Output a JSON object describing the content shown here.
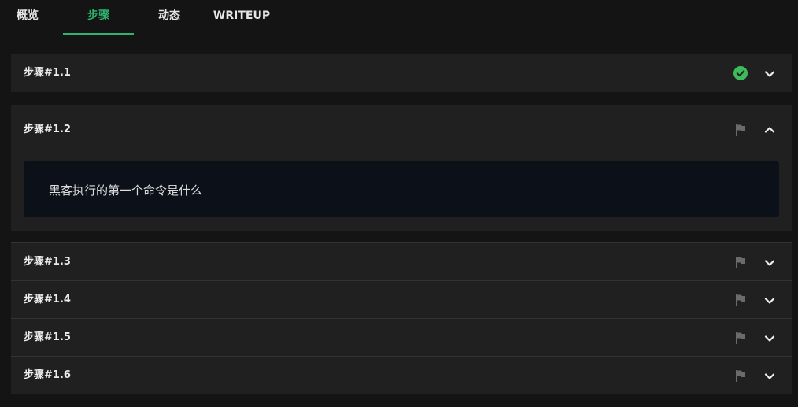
{
  "tabs": [
    {
      "label": "概览",
      "active": false
    },
    {
      "label": "步骤",
      "active": true
    },
    {
      "label": "动态",
      "active": false
    },
    {
      "label": "WRITEUP",
      "active": false
    }
  ],
  "steps": [
    {
      "title": "步骤#1.1",
      "status": "solved",
      "status_icon": "check-circle-icon",
      "expanded": false
    },
    {
      "title": "步骤#1.2",
      "status": "unsolved",
      "status_icon": "flag-icon",
      "expanded": true,
      "question": "黑客执行的第一个命令是什么"
    },
    {
      "title": "步骤#1.3",
      "status": "unsolved",
      "status_icon": "flag-icon",
      "expanded": false
    },
    {
      "title": "步骤#1.4",
      "status": "unsolved",
      "status_icon": "flag-icon",
      "expanded": false
    },
    {
      "title": "步骤#1.5",
      "status": "unsolved",
      "status_icon": "flag-icon",
      "expanded": false
    },
    {
      "title": "步骤#1.6",
      "status": "unsolved",
      "status_icon": "flag-icon",
      "expanded": false
    }
  ],
  "colors": {
    "accent": "#2fb36e",
    "solved": "#3dbb5a",
    "flag": "#6b6b6b",
    "panel": "#202020",
    "background": "#141414",
    "question_box": "#0c1119"
  }
}
